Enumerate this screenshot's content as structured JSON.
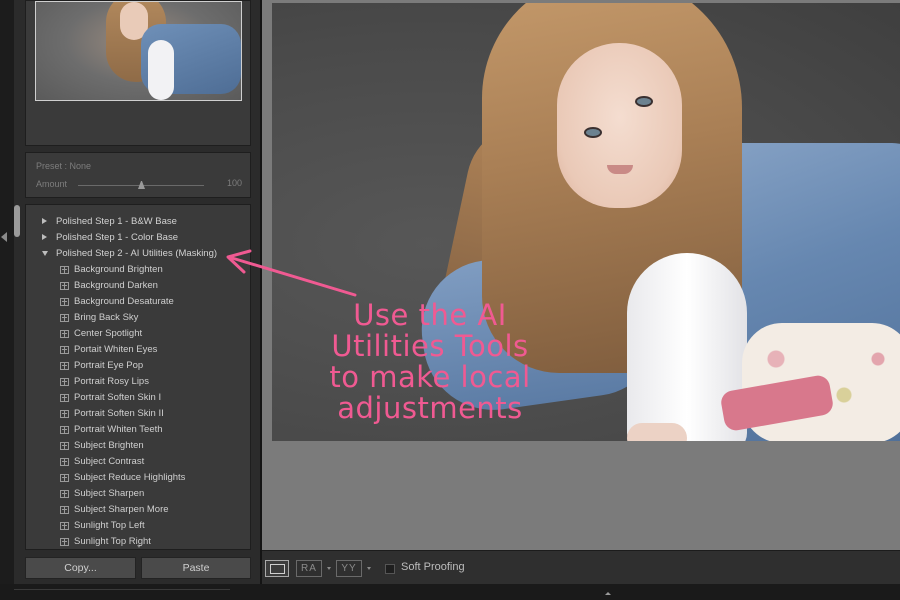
{
  "preset_box": {
    "preset_text": "Preset : None",
    "amount_label": "Amount",
    "amount_value": "100",
    "amount_level_percent": 50
  },
  "presets": {
    "groups": [
      {
        "label": "Polished Step 1 - B&W Base",
        "expanded": false
      },
      {
        "label": "Polished Step 1 - Color Base",
        "expanded": false
      },
      {
        "label": "Polished Step 2 - AI Utilities (Masking)",
        "expanded": true
      }
    ],
    "items": [
      "Background Brighten",
      "Background Darken",
      "Background Desaturate",
      "Bring Back Sky",
      "Center Spotlight",
      "Portait Whiten Eyes",
      "Portrait Eye Pop",
      "Portrait Rosy Lips",
      "Portrait Soften Skin I",
      "Portrait Soften Skin II",
      "Portrait Whiten Teeth",
      "Subject Brighten",
      "Subject Contrast",
      "Subject Reduce Highlights",
      "Subject Sharpen",
      "Subject Sharpen More",
      "Sunlight Top Left",
      "Sunlight Top Right"
    ]
  },
  "buttons": {
    "copy": "Copy...",
    "paste": "Paste"
  },
  "annotation": {
    "text_lines": [
      "Use the AI",
      "Utilities Tools",
      "to make local",
      "adjustments"
    ],
    "color": "#f05a92"
  },
  "toolbar": {
    "ra_label": "RA",
    "yy_label": "YY",
    "soft_proofing": "Soft Proofing",
    "soft_proofing_checked": false
  },
  "icons": {
    "left_collapse": "triangle-left-icon",
    "group_closed": "disclosure-right-icon",
    "group_open": "disclosure-down-icon",
    "preset_item": "preset-icon",
    "view_mode": "loupe-view-icon"
  }
}
